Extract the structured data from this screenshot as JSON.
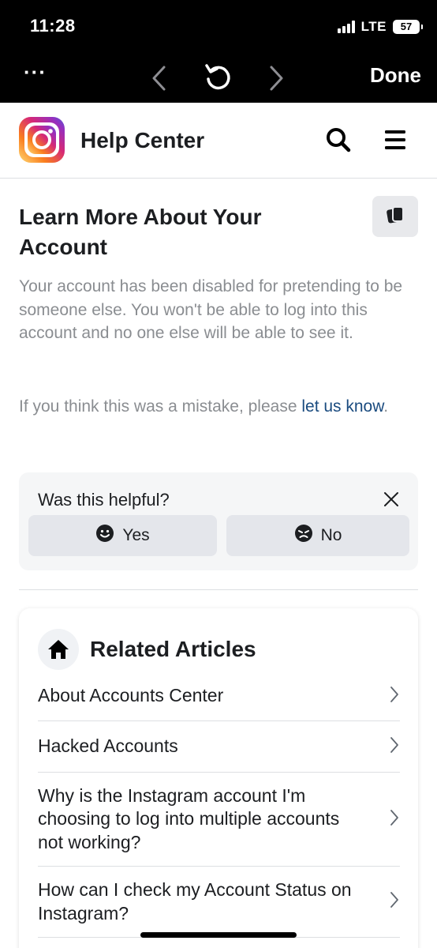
{
  "status_bar": {
    "time": "11:28",
    "network": "LTE",
    "battery": "57"
  },
  "browser_nav": {
    "more_icon": "ellipsis-icon",
    "done_label": "Done"
  },
  "header": {
    "title": "Help Center",
    "logo": "instagram-logo"
  },
  "article": {
    "title": "Learn More About Your Account",
    "body": "Your account has been disabled for pretending to be someone else. You won't be able to log into this account and no one else will be able to see it.",
    "body2_prefix": "If you think this was a mistake, please ",
    "body2_link": "let us know",
    "body2_suffix": "."
  },
  "feedback": {
    "question": "Was this helpful?",
    "yes_label": "Yes",
    "no_label": "No"
  },
  "related": {
    "title": "Related Articles",
    "items": [
      {
        "label": "About Accounts Center"
      },
      {
        "label": "Hacked Accounts"
      },
      {
        "label": "Why is the Instagram account I'm choosing to log into multiple accounts not working?"
      },
      {
        "label": "How can I check my Account Status on Instagram?"
      }
    ]
  },
  "colors": {
    "chrome_bg": "#000000",
    "body_text_muted": "#8a8d91",
    "link": "#1a4b7f",
    "card_bg": "#f5f6f7",
    "button_bg": "#e4e6eb"
  }
}
